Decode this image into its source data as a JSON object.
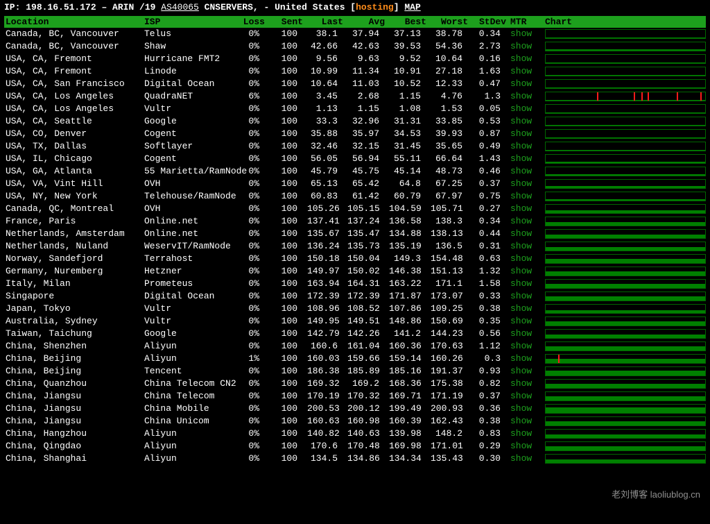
{
  "header": {
    "ip_label": "IP: ",
    "ip": "198.16.51.172",
    "sep": " – ",
    "registry": "ARIN /19 ",
    "asn": "AS40065",
    "org": " CNSERVERS, - United States [",
    "tag": "hosting",
    "close": "] ",
    "map": "MAP"
  },
  "columns": [
    "Location",
    "ISP",
    "Loss",
    "Sent",
    "Last",
    "Avg",
    "Best",
    "Worst",
    "StDev",
    "MTR",
    "Chart"
  ],
  "mtr_label": "show",
  "rows": [
    {
      "location": "Canada, BC, Vancouver",
      "isp": "Telus",
      "loss": "0%",
      "sent": "100",
      "last": "38.1",
      "avg": "37.94",
      "best": "37.13",
      "worst": "38.78",
      "stdev": "0.34",
      "bar": 0.12,
      "spikes": []
    },
    {
      "location": "Canada, BC, Vancouver",
      "isp": "Shaw",
      "loss": "0%",
      "sent": "100",
      "last": "42.66",
      "avg": "42.63",
      "best": "39.53",
      "worst": "54.36",
      "stdev": "2.73",
      "bar": 0.14,
      "spikes": []
    },
    {
      "location": "USA, CA, Fremont",
      "isp": "Hurricane FMT2",
      "loss": "0%",
      "sent": "100",
      "last": "9.56",
      "avg": "9.63",
      "best": "9.52",
      "worst": "10.64",
      "stdev": "0.16",
      "bar": 0.05,
      "spikes": []
    },
    {
      "location": "USA, CA, Fremont",
      "isp": "Linode",
      "loss": "0%",
      "sent": "100",
      "last": "10.99",
      "avg": "11.34",
      "best": "10.91",
      "worst": "27.18",
      "stdev": "1.63",
      "bar": 0.06,
      "spikes": []
    },
    {
      "location": "USA, CA, San Francisco",
      "isp": "Digital Ocean",
      "loss": "0%",
      "sent": "100",
      "last": "10.64",
      "avg": "11.03",
      "best": "10.52",
      "worst": "12.33",
      "stdev": "0.47",
      "bar": 0.06,
      "spikes": []
    },
    {
      "location": "USA, CA, Los Angeles",
      "isp": "QuadraNET",
      "loss": "6%",
      "sent": "100",
      "last": "3.45",
      "avg": "2.68",
      "best": "1.15",
      "worst": "4.76",
      "stdev": "1.3",
      "bar": 0.03,
      "spikes": [
        0.32,
        0.55,
        0.6,
        0.64,
        0.82,
        0.97
      ]
    },
    {
      "location": "USA, CA, Los Angeles",
      "isp": "Vultr",
      "loss": "0%",
      "sent": "100",
      "last": "1.13",
      "avg": "1.15",
      "best": "1.08",
      "worst": "1.53",
      "stdev": "0.05",
      "bar": 0.03,
      "spikes": []
    },
    {
      "location": "USA, CA, Seattle",
      "isp": "Google",
      "loss": "0%",
      "sent": "100",
      "last": "33.3",
      "avg": "32.96",
      "best": "31.31",
      "worst": "33.85",
      "stdev": "0.53",
      "bar": 0.11,
      "spikes": []
    },
    {
      "location": "USA, CO, Denver",
      "isp": "Cogent",
      "loss": "0%",
      "sent": "100",
      "last": "35.88",
      "avg": "35.97",
      "best": "34.53",
      "worst": "39.93",
      "stdev": "0.87",
      "bar": 0.12,
      "spikes": []
    },
    {
      "location": "USA, TX, Dallas",
      "isp": "Softlayer",
      "loss": "0%",
      "sent": "100",
      "last": "32.46",
      "avg": "32.15",
      "best": "31.45",
      "worst": "35.65",
      "stdev": "0.49",
      "bar": 0.11,
      "spikes": []
    },
    {
      "location": "USA, IL, Chicago",
      "isp": "Cogent",
      "loss": "0%",
      "sent": "100",
      "last": "56.05",
      "avg": "56.94",
      "best": "55.11",
      "worst": "66.64",
      "stdev": "1.43",
      "bar": 0.18,
      "spikes": []
    },
    {
      "location": "USA, GA, Atlanta",
      "isp": "55 Marietta/RamNode",
      "loss": "0%",
      "sent": "100",
      "last": "45.79",
      "avg": "45.75",
      "best": "45.14",
      "worst": "48.73",
      "stdev": "0.46",
      "bar": 0.15,
      "spikes": []
    },
    {
      "location": "USA, VA, Vint Hill",
      "isp": "OVH",
      "loss": "0%",
      "sent": "100",
      "last": "65.13",
      "avg": "65.42",
      "best": "64.8",
      "worst": "67.25",
      "stdev": "0.37",
      "bar": 0.21,
      "spikes": []
    },
    {
      "location": "USA, NY, New York",
      "isp": "Telehouse/RamNode",
      "loss": "0%",
      "sent": "100",
      "last": "60.83",
      "avg": "61.42",
      "best": "60.79",
      "worst": "67.97",
      "stdev": "0.75",
      "bar": 0.2,
      "spikes": []
    },
    {
      "location": "Canada, QC, Montreal",
      "isp": "OVH",
      "loss": "0%",
      "sent": "100",
      "last": "105.26",
      "avg": "105.15",
      "best": "104.59",
      "worst": "105.71",
      "stdev": "0.27",
      "bar": 0.33,
      "spikes": []
    },
    {
      "location": "France, Paris",
      "isp": "Online.net",
      "loss": "0%",
      "sent": "100",
      "last": "137.41",
      "avg": "137.24",
      "best": "136.58",
      "worst": "138.3",
      "stdev": "0.34",
      "bar": 0.43,
      "spikes": []
    },
    {
      "location": "Netherlands, Amsterdam",
      "isp": "Online.net",
      "loss": "0%",
      "sent": "100",
      "last": "135.67",
      "avg": "135.47",
      "best": "134.88",
      "worst": "138.13",
      "stdev": "0.44",
      "bar": 0.43,
      "spikes": []
    },
    {
      "location": "Netherlands, Nuland",
      "isp": "WeservIT/RamNode",
      "loss": "0%",
      "sent": "100",
      "last": "136.24",
      "avg": "135.73",
      "best": "135.19",
      "worst": "136.5",
      "stdev": "0.31",
      "bar": 0.43,
      "spikes": []
    },
    {
      "location": "Norway, Sandefjord",
      "isp": "Terrahost",
      "loss": "0%",
      "sent": "100",
      "last": "150.18",
      "avg": "150.04",
      "best": "149.3",
      "worst": "154.48",
      "stdev": "0.63",
      "bar": 0.47,
      "spikes": []
    },
    {
      "location": "Germany, Nuremberg",
      "isp": "Hetzner",
      "loss": "0%",
      "sent": "100",
      "last": "149.97",
      "avg": "150.02",
      "best": "146.38",
      "worst": "151.13",
      "stdev": "1.32",
      "bar": 0.47,
      "spikes": []
    },
    {
      "location": "Italy, Milan",
      "isp": "Prometeus",
      "loss": "0%",
      "sent": "100",
      "last": "163.94",
      "avg": "164.31",
      "best": "163.22",
      "worst": "171.1",
      "stdev": "1.58",
      "bar": 0.52,
      "spikes": []
    },
    {
      "location": "Singapore",
      "isp": "Digital Ocean",
      "loss": "0%",
      "sent": "100",
      "last": "172.39",
      "avg": "172.39",
      "best": "171.87",
      "worst": "173.07",
      "stdev": "0.33",
      "bar": 0.54,
      "spikes": []
    },
    {
      "location": "Japan, Tokyo",
      "isp": "Vultr",
      "loss": "0%",
      "sent": "100",
      "last": "108.96",
      "avg": "108.52",
      "best": "107.86",
      "worst": "109.25",
      "stdev": "0.38",
      "bar": 0.34,
      "spikes": []
    },
    {
      "location": "Australia, Sydney",
      "isp": "Vultr",
      "loss": "0%",
      "sent": "100",
      "last": "149.95",
      "avg": "149.51",
      "best": "148.86",
      "worst": "150.69",
      "stdev": "0.35",
      "bar": 0.47,
      "spikes": []
    },
    {
      "location": "Taiwan, Taichung",
      "isp": "Google",
      "loss": "0%",
      "sent": "100",
      "last": "142.79",
      "avg": "142.26",
      "best": "141.2",
      "worst": "144.23",
      "stdev": "0.56",
      "bar": 0.45,
      "spikes": []
    },
    {
      "location": "China, Shenzhen",
      "isp": "Aliyun",
      "loss": "0%",
      "sent": "100",
      "last": "160.6",
      "avg": "161.04",
      "best": "160.36",
      "worst": "170.63",
      "stdev": "1.12",
      "bar": 0.51,
      "spikes": []
    },
    {
      "location": "China, Beijing",
      "isp": "Aliyun",
      "loss": "1%",
      "sent": "100",
      "last": "160.03",
      "avg": "159.66",
      "best": "159.14",
      "worst": "160.26",
      "stdev": "0.3",
      "bar": 0.5,
      "spikes": [
        0.08
      ]
    },
    {
      "location": "China, Beijing",
      "isp": "Tencent",
      "loss": "0%",
      "sent": "100",
      "last": "186.38",
      "avg": "185.89",
      "best": "185.16",
      "worst": "191.37",
      "stdev": "0.93",
      "bar": 0.59,
      "spikes": []
    },
    {
      "location": "China, Quanzhou",
      "isp": "China Telecom CN2",
      "loss": "0%",
      "sent": "100",
      "last": "169.32",
      "avg": "169.2",
      "best": "168.36",
      "worst": "175.38",
      "stdev": "0.82",
      "bar": 0.53,
      "spikes": []
    },
    {
      "location": "China, Jiangsu",
      "isp": "China Telecom",
      "loss": "0%",
      "sent": "100",
      "last": "170.19",
      "avg": "170.32",
      "best": "169.71",
      "worst": "171.19",
      "stdev": "0.37",
      "bar": 0.54,
      "spikes": []
    },
    {
      "location": "China, Jiangsu",
      "isp": "China Mobile",
      "loss": "0%",
      "sent": "100",
      "last": "200.53",
      "avg": "200.12",
      "best": "199.49",
      "worst": "200.93",
      "stdev": "0.36",
      "bar": 0.63,
      "spikes": []
    },
    {
      "location": "China, Jiangsu",
      "isp": "China Unicom",
      "loss": "0%",
      "sent": "100",
      "last": "160.63",
      "avg": "160.98",
      "best": "160.39",
      "worst": "162.43",
      "stdev": "0.38",
      "bar": 0.51,
      "spikes": []
    },
    {
      "location": "China, Hangzhou",
      "isp": "Aliyun",
      "loss": "0%",
      "sent": "100",
      "last": "140.82",
      "avg": "140.63",
      "best": "139.98",
      "worst": "148.2",
      "stdev": "0.83",
      "bar": 0.44,
      "spikes": []
    },
    {
      "location": "China, Qingdao",
      "isp": "Aliyun",
      "loss": "0%",
      "sent": "100",
      "last": "170.6",
      "avg": "170.48",
      "best": "169.98",
      "worst": "171.01",
      "stdev": "0.29",
      "bar": 0.54,
      "spikes": []
    },
    {
      "location": "China, Shanghai",
      "isp": "Aliyun",
      "loss": "0%",
      "sent": "100",
      "last": "134.5",
      "avg": "134.86",
      "best": "134.34",
      "worst": "135.43",
      "stdev": "0.30",
      "bar": 0.43,
      "spikes": []
    }
  ],
  "watermark": "老刘博客 laoliublog.cn"
}
